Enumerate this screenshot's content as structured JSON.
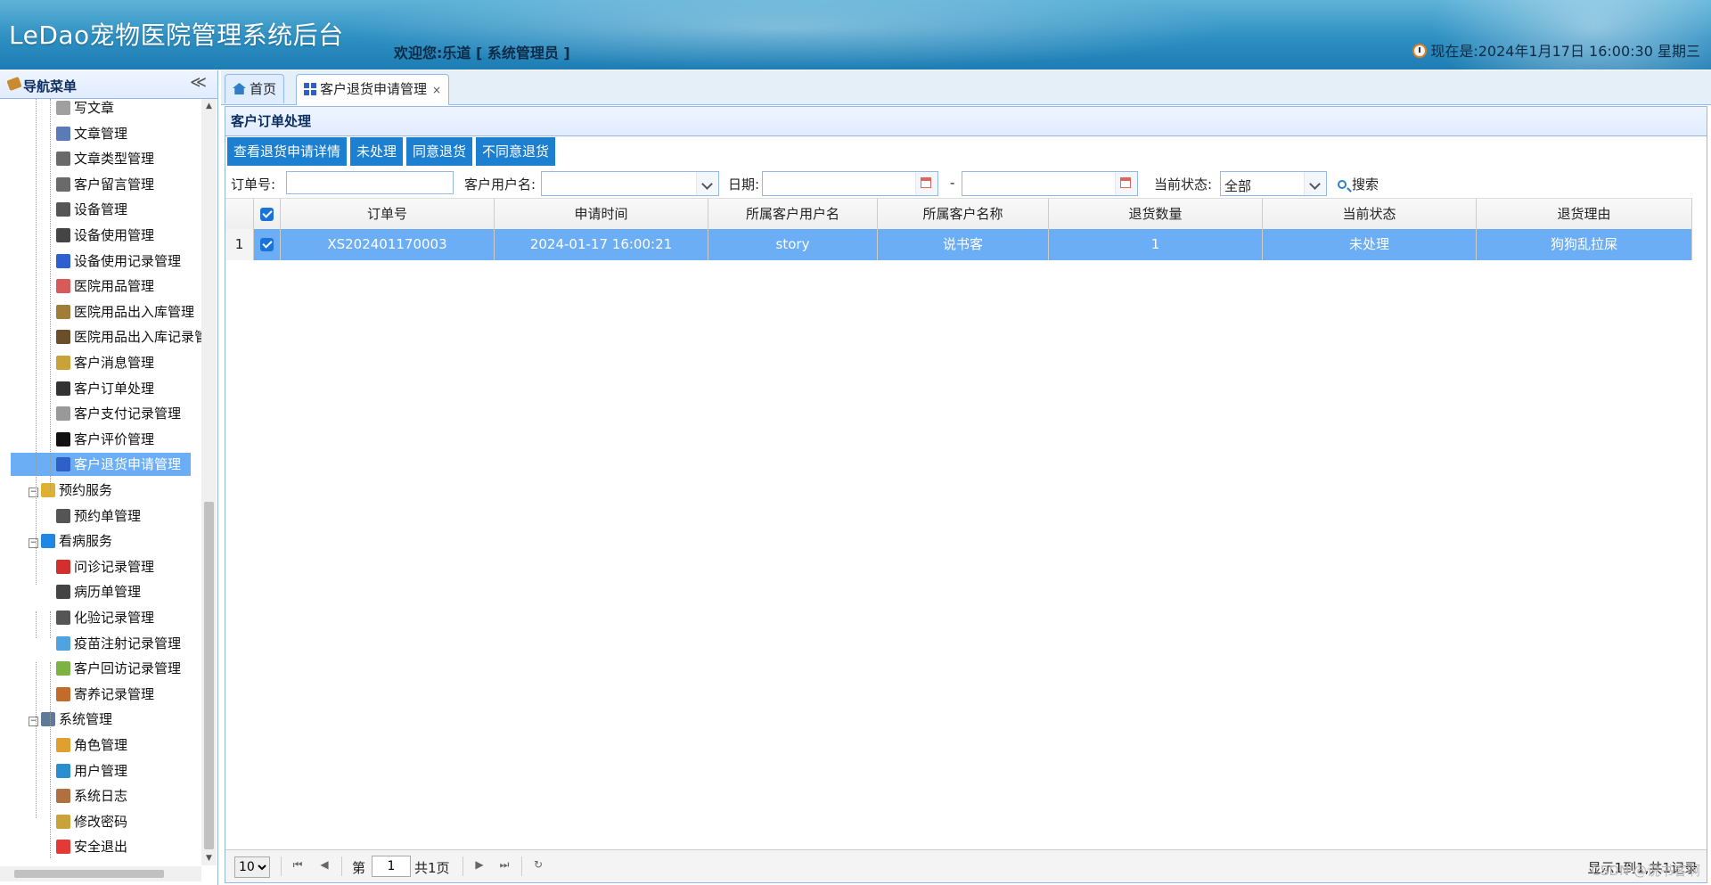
{
  "header": {
    "app_title": "LeDao宠物医院管理系统后台",
    "welcome": "欢迎您:乐道 [ 系统管理员 ]",
    "datetime": "现在是:2024年1月17日 16:00:30 星期三"
  },
  "nav": {
    "title": "导航菜单",
    "collapse_glyph": "≪",
    "items": [
      {
        "label": "写文章",
        "icon": "pen-icon"
      },
      {
        "label": "文章管理",
        "icon": "doc-icon"
      },
      {
        "label": "文章类型管理",
        "icon": "type-icon"
      },
      {
        "label": "客户留言管理",
        "icon": "chat-icon"
      },
      {
        "label": "设备管理",
        "icon": "tools-icon"
      },
      {
        "label": "设备使用管理",
        "icon": "device-icon"
      },
      {
        "label": "设备使用记录管理",
        "icon": "record-icon"
      },
      {
        "label": "医院用品管理",
        "icon": "bottle-icon"
      },
      {
        "label": "医院用品出入库管理",
        "icon": "stock-icon"
      },
      {
        "label": "医院用品出入库记录管",
        "icon": "warehouse-icon"
      },
      {
        "label": "客户消息管理",
        "icon": "message-icon"
      },
      {
        "label": "客户订单处理",
        "icon": "order-icon"
      },
      {
        "label": "客户支付记录管理",
        "icon": "payment-icon"
      },
      {
        "label": "客户评价管理",
        "icon": "thumb-icon"
      },
      {
        "label": "客户退货申请管理",
        "icon": "grid-icon"
      },
      {
        "label": "预约服务",
        "icon": "folder-icon"
      },
      {
        "label": "预约单管理",
        "icon": "reserve-icon"
      },
      {
        "label": "看病服务",
        "icon": "medical-icon"
      },
      {
        "label": "问诊记录管理",
        "icon": "consult-icon"
      },
      {
        "label": "病历单管理",
        "icon": "case-icon"
      },
      {
        "label": "化验记录管理",
        "icon": "microscope-icon"
      },
      {
        "label": "疫苗注射记录管理",
        "icon": "syringe-icon"
      },
      {
        "label": "客户回访记录管理",
        "icon": "visit-icon"
      },
      {
        "label": "寄养记录管理",
        "icon": "house-icon"
      },
      {
        "label": "系统管理",
        "icon": "computer-icon"
      },
      {
        "label": "角色管理",
        "icon": "role-icon"
      },
      {
        "label": "用户管理",
        "icon": "users-icon"
      },
      {
        "label": "系统日志",
        "icon": "log-icon"
      },
      {
        "label": "修改密码",
        "icon": "key-icon"
      },
      {
        "label": "安全退出",
        "icon": "exit-icon"
      }
    ],
    "expander_glyph": "−"
  },
  "tabs": [
    {
      "label": "首页",
      "icon": "home-icon"
    },
    {
      "label": "客户退货申请管理",
      "icon": "grid-icon",
      "close": "×"
    }
  ],
  "panel": {
    "title": "客户订单处理",
    "toolbar": [
      "查看退货申请详情",
      "未处理",
      "同意退货",
      "不同意退货"
    ],
    "filters": {
      "order_no_label": "订单号:",
      "username_label": "客户用户名:",
      "date_label": "日期:",
      "date_sep": "-",
      "status_label": "当前状态:",
      "status_value": "全部",
      "search_label": "搜索"
    },
    "grid": {
      "columns": [
        "订单号",
        "申请时间",
        "所属客户用户名",
        "所属客户名称",
        "退货数量",
        "当前状态",
        "退货理由"
      ],
      "rows": [
        {
          "num": "1",
          "cells": [
            "XS202401170003",
            "2024-01-17 16:00:21",
            "story",
            "说书客",
            "1",
            "未处理",
            "狗狗乱拉屎"
          ]
        }
      ]
    },
    "pager": {
      "page_size": "10",
      "page_prefix": "第",
      "page_value": "1",
      "page_suffix": "共1页",
      "info": "显示1到1,共1记录",
      "first_glyph": "⏮",
      "prev_glyph": "◀",
      "next_glyph": "▶",
      "last_glyph": "⏭",
      "refresh_glyph": "↻"
    }
  },
  "watermark": "CSDN @说书客啊",
  "colors": {
    "accent": "#1d7fd0",
    "selected": "#6caef5",
    "border": "#95b8e7"
  }
}
